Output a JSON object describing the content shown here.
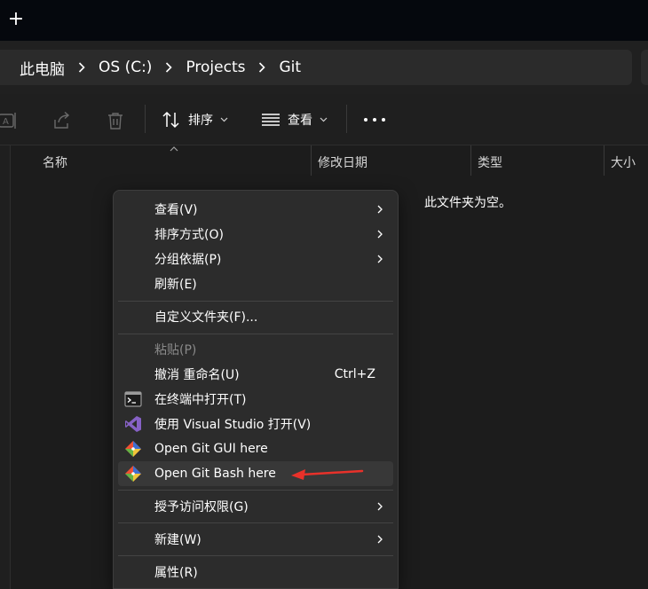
{
  "titlebar": {
    "new_tab_label": "+"
  },
  "breadcrumb": [
    "此电脑",
    "OS (C:)",
    "Projects",
    "Git"
  ],
  "toolbar": {
    "sort_label": "排序",
    "view_label": "查看"
  },
  "columns": {
    "name": "名称",
    "modified": "修改日期",
    "type": "类型",
    "size": "大小"
  },
  "empty_message": "此文件夹为空。",
  "context_menu": {
    "items": [
      {
        "label": "查看(V)",
        "submenu": true
      },
      {
        "label": "排序方式(O)",
        "submenu": true
      },
      {
        "label": "分组依据(P)",
        "submenu": true
      },
      {
        "label": "刷新(E)"
      },
      {
        "label": "自定义文件夹(F)..."
      },
      {
        "label": "粘贴(P)",
        "disabled": true
      },
      {
        "label": "撤消 重命名(U)",
        "shortcut": "Ctrl+Z"
      },
      {
        "label": "在终端中打开(T)",
        "icon": "terminal-icon"
      },
      {
        "label": "使用 Visual Studio 打开(V)",
        "icon": "visual-studio-icon"
      },
      {
        "label": "Open Git GUI here",
        "icon": "git-icon"
      },
      {
        "label": "Open Git Bash here",
        "icon": "git-icon",
        "highlighted": true
      },
      {
        "label": "授予访问权限(G)",
        "submenu": true
      },
      {
        "label": "新建(W)",
        "submenu": true
      },
      {
        "label": "属性(R)"
      }
    ]
  },
  "colors": {
    "background": "#1c1c1c",
    "menu_background": "#2c2c2c",
    "annotation_arrow": "#e8312a",
    "git_orange": "#f05033",
    "vs_purple": "#8661c5"
  }
}
